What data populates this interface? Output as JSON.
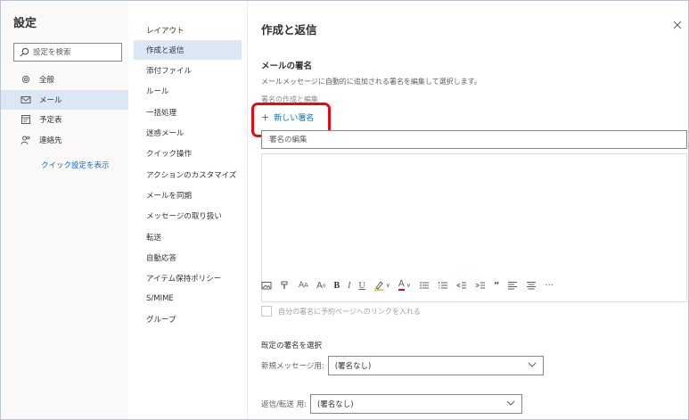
{
  "left_pane": {
    "title": "設定",
    "search_placeholder": "設定を検索",
    "nav": [
      {
        "label": "全般",
        "icon": "gear-icon"
      },
      {
        "label": "メール",
        "icon": "mail-icon",
        "active": true
      },
      {
        "label": "予定表",
        "icon": "calendar-icon"
      },
      {
        "label": "連絡先",
        "icon": "people-icon"
      }
    ],
    "quick_settings_link": "クイック設定を表示"
  },
  "middle_pane": {
    "items": [
      {
        "label": "レイアウト"
      },
      {
        "label": "作成と返信",
        "active": true
      },
      {
        "label": "添付ファイル"
      },
      {
        "label": "ルール"
      },
      {
        "label": "一括処理"
      },
      {
        "label": "迷惑メール"
      },
      {
        "label": "クイック操作"
      },
      {
        "label": "アクションのカスタマイズ"
      },
      {
        "label": "メールを同期"
      },
      {
        "label": "メッセージの取り扱い"
      },
      {
        "label": "転送"
      },
      {
        "label": "自動応答"
      },
      {
        "label": "アイテム保持ポリシー"
      },
      {
        "label": "S/MIME"
      },
      {
        "label": "グループ"
      }
    ]
  },
  "right_pane": {
    "title": "作成と返信",
    "section_title": "メールの署名",
    "section_desc": "メールメッセージに自動的に追加される署名を編集して選択します。",
    "obscured_label": "署名の作成と編集",
    "new_signature_button": "新しい署名",
    "signature_name_placeholder": "署名の編集",
    "checkbox_label": "自分の署名に予約ページへのリンクを入れる",
    "default_signature_title": "既定の署名を選択",
    "new_messages_label": "新規メッセージ用:",
    "new_messages_value": "(署名なし)",
    "replies_label": "返信/転送 用:",
    "replies_value": "(署名なし)"
  },
  "toolbar_icons": [
    "image-icon",
    "format-painter-icon",
    "font-size-icon",
    "superscript-icon",
    "bold-icon",
    "italic-icon",
    "underline-icon",
    "highlight-icon",
    "font-color-icon",
    "bullets-icon",
    "numbering-icon",
    "decrease-indent-icon",
    "increase-indent-icon",
    "quote-icon",
    "align-left-icon",
    "align-center-icon",
    "more-icon"
  ],
  "colors": {
    "accent": "#0f6cbd",
    "highlight_box": "#e8090c",
    "active_bg": "#dbe7f5"
  }
}
